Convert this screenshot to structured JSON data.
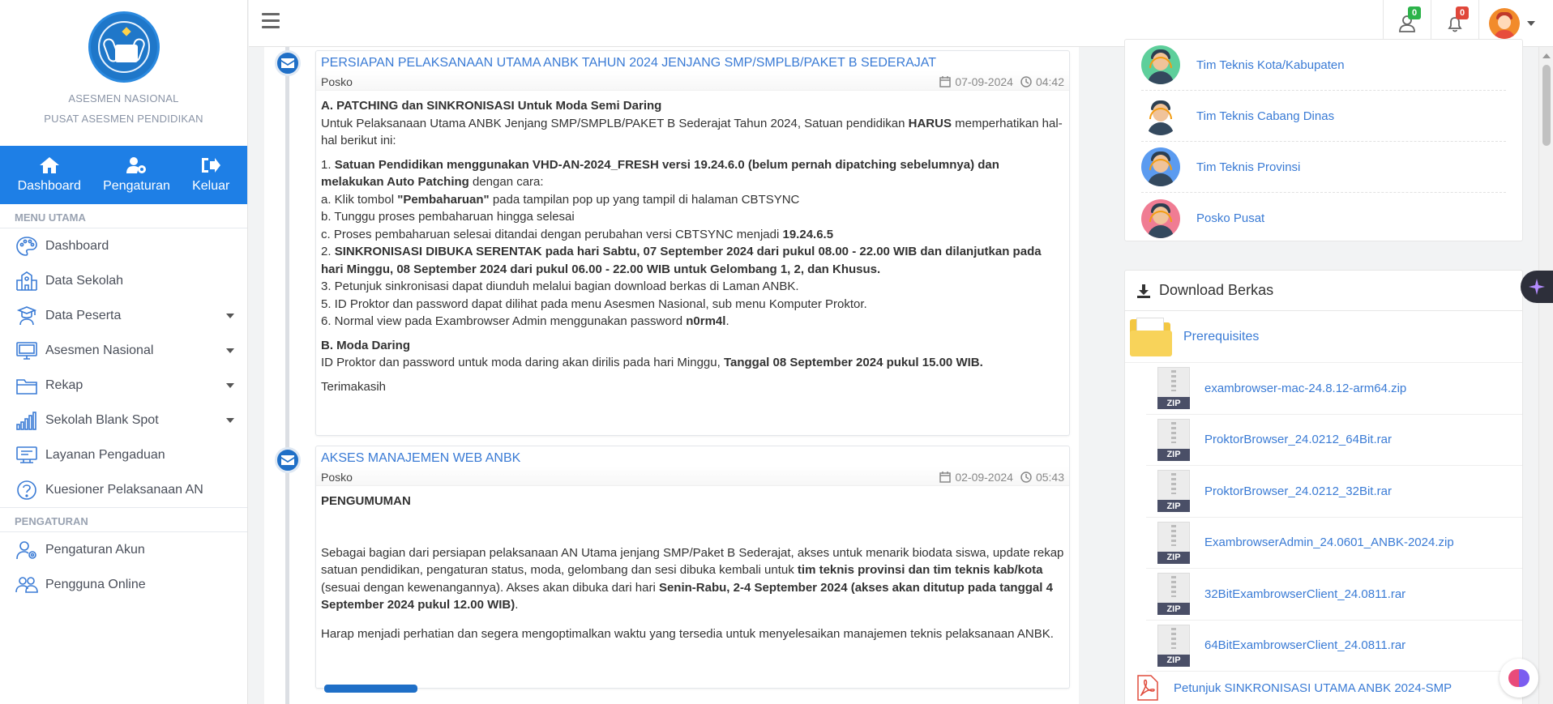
{
  "sidebar": {
    "org_line1": "ASESMEN NASIONAL",
    "org_line2": "PUSAT ASESMEN PENDIDIKAN",
    "quick": {
      "dashboard": "Dashboard",
      "pengaturan": "Pengaturan",
      "keluar": "Keluar"
    },
    "section_main": "MENU UTAMA",
    "main_items": [
      {
        "label": "Dashboard",
        "icon": "palette-icon"
      },
      {
        "label": "Data Sekolah",
        "icon": "school-icon"
      },
      {
        "label": "Data Peserta",
        "icon": "students-icon"
      },
      {
        "label": "Asesmen Nasional",
        "icon": "monitor-icon"
      },
      {
        "label": "Rekap",
        "icon": "folder-icon"
      },
      {
        "label": "Sekolah Blank Spot",
        "icon": "signal-bars-icon"
      },
      {
        "label": "Layanan Pengaduan",
        "icon": "support-icon"
      },
      {
        "label": "Kuesioner Pelaksanaan AN",
        "icon": "question-icon"
      }
    ],
    "section_settings": "PENGATURAN",
    "settings_items": [
      {
        "label": "Pengaturan Akun",
        "icon": "user-gear-icon"
      },
      {
        "label": "Pengguna Online",
        "icon": "users-icon"
      }
    ]
  },
  "topbar": {
    "user_badge": "0",
    "notif_badge": "0"
  },
  "timeline": [
    {
      "title": "PERSIAPAN PELAKSANAAN UTAMA ANBK TAHUN 2024 JENJANG SMP/SMPLB/PAKET B SEDERAJAT",
      "author": "Posko",
      "date": "07-09-2024",
      "time": "04:42"
    },
    {
      "title": "AKSES MANAJEMEN WEB ANBK",
      "author": "Posko",
      "date": "02-09-2024",
      "time": "05:43"
    }
  ],
  "post1": {
    "h_a": "A. PATCHING dan SINKRONISASI Untuk Moda Semi Daring",
    "intro_a": "Untuk Pelaksanaan Utama ANBK Jenjang SMP/SMPLB/PAKET B Sederajat Tahun 2024, Satuan pendidikan ",
    "intro_b": "HARUS",
    "intro_c": " memperhatikan hal-hal berikut ini:",
    "item1_num": "1. ",
    "item1_bold": "Satuan Pendidikan menggunakan VHD-AN-2024_FRESH versi 19.24.6.0 (belum pernah dipatching sebelumnya) dan melakukan Auto Patching",
    "item1_rest": " dengan cara:",
    "sub_a_pre": "a. Klik tombol ",
    "sub_a_bold": "\"Pembaharuan\"",
    "sub_a_post": " pada tampilan pop up yang tampil di halaman CBTSYNC",
    "sub_b": "b. Tunggu proses pembaharuan hingga selesai",
    "sub_c_pre": "c. Proses pembaharuan selesai ditandai dengan perubahan versi CBTSYNC menjadi ",
    "sub_c_bold": "19.24.6.5",
    "item2_num": "2. ",
    "item2_bold": "SINKRONISASI DIBUKA SERENTAK pada hari Sabtu, 07 September 2024 dari pukul 08.00 - 22.00 WIB dan dilanjutkan pada hari Minggu, 08 September 2024 dari pukul 06.00 - 22.00 WIB untuk Gelombang 1, 2, dan Khusus.",
    "item3": "3. Petunjuk sinkronisasi dapat diunduh melalui bagian download berkas di Laman ANBK.",
    "item5": "5. ID Proktor dan password dapat dilihat pada menu Asesmen Nasional, sub menu Komputer Proktor.",
    "item6_pre": "6. Normal view pada Exambrowser Admin menggunakan password ",
    "item6_bold": "n0rm4l",
    "item6_post": ".",
    "h_b": "B. Moda Daring",
    "b_pre": "ID Proktor dan password untuk moda daring akan dirilis pada hari Minggu, ",
    "b_bold": "Tanggal 08 September 2024 pukul 15.00 WIB.",
    "thanks": "Terimakasih"
  },
  "post2": {
    "heading": "PENGUMUMAN",
    "p1_a": "Sebagai bagian dari persiapan pelaksanaan AN Utama jenjang SMP/Paket B Sederajat, akses untuk menarik biodata siswa, update rekap satuan pendidikan, pengaturan status, moda, gelombang dan sesi dibuka kembali untuk ",
    "p1_b": "tim teknis provinsi dan tim teknis kab/kota",
    "p1_c": " (sesuai dengan kewenangannya). Akses akan dibuka dari hari ",
    "p1_d": "Senin-Rabu, 2-4 September 2024 (akses akan ditutup pada tanggal 4 September 2024 pukul 12.00 WIB)",
    "p1_e": ".",
    "p2": "Harap menjadi perhatian dan segera mengoptimalkan waktu yang tersedia untuk menyelesaikan manajemen teknis pelaksanaan ANBK."
  },
  "posko": [
    {
      "label": "Tim Teknis Kota/Kabupaten",
      "bg": "#5ecf9b"
    },
    {
      "label": "Tim Teknis Cabang Dinas",
      "bg": "#ffffff"
    },
    {
      "label": "Tim Teknis Provinsi",
      "bg": "#5b9bf0"
    },
    {
      "label": "Posko Pusat",
      "bg": "#f07c93"
    }
  ],
  "download": {
    "title": "Download Berkas",
    "folder": "Prerequisites",
    "zip_label": "ZIP",
    "files": [
      "exambrowser-mac-24.8.12-arm64.zip",
      "ProktorBrowser_24.0212_64Bit.rar",
      "ProktorBrowser_24.0212_32Bit.rar",
      "ExambrowserAdmin_24.0601_ANBK-2024.zip",
      "32BitExambrowserClient_24.0811.rar",
      "64BitExambrowserClient_24.0811.rar"
    ],
    "pdf": "Petunjuk SINKRONISASI UTAMA ANBK 2024-SMP"
  },
  "colors": {
    "primary": "#1e7fe6",
    "link": "#3a7bd5",
    "timeline_icon": "#1f6fc7"
  }
}
